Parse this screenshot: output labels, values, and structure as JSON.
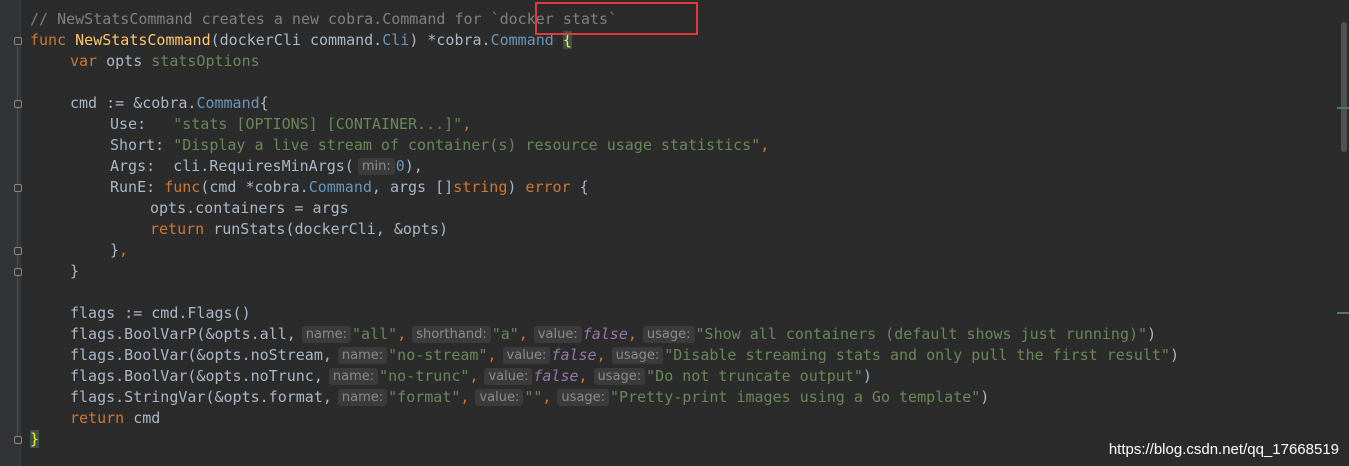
{
  "editor": {
    "lines": {
      "l1": {
        "comment_a": "// NewStatsCommand creates a new cobra.Command for ",
        "comment_b": "`docker stats`"
      },
      "l2": {
        "kw": "func",
        "name": "NewStatsCommand",
        "params": "(dockerCli command.",
        "cli_type": "Cli",
        "ret": ") *cobra.",
        "ret_type": "Command",
        "brace": "{"
      },
      "l3": {
        "kw": "var",
        "ident": " opts ",
        "type": "statsOptions"
      },
      "l5": {
        "text": "cmd := &cobra.",
        "type": "Command",
        "brace": "{"
      },
      "l6": {
        "key": "Use:   ",
        "str": "\"stats [OPTIONS] [CONTAINER...]\"",
        "end": ","
      },
      "l7": {
        "key": "Short: ",
        "str": "\"Display a live stream of container(s) resource usage statistics\"",
        "end": ","
      },
      "l8": {
        "key": "Args:  cli.RequiresMinArgs(",
        "hint": "min:",
        "num": "0",
        "end": "),"
      },
      "l9": {
        "key": "RunE: ",
        "kw": "func",
        "params": "(cmd *cobra.",
        "type": "Command",
        "mid": ", args []",
        "t2": "string",
        "end": ") ",
        "kw2": "error",
        "brace": " {"
      },
      "l10": {
        "text": "opts.containers = args"
      },
      "l11": {
        "kw": "return",
        "text": " runStats(dockerCli, &opts)"
      },
      "l12": {
        "text": "}",
        "end": ","
      },
      "l13": {
        "text": "}"
      },
      "l15": {
        "text": "flags := cmd.Flags()"
      },
      "l16": {
        "call": "flags.BoolVarP(&opts.all,",
        "h1": "name:",
        "v1": "\"all\"",
        "c1": ",",
        "h2": "shorthand:",
        "v2": "\"a\"",
        "c2": ",",
        "h3": "value:",
        "v3": "false",
        "c3": ",",
        "h4": "usage:",
        "v4": "\"Show all containers (default shows just running)\"",
        "end": ")"
      },
      "l17": {
        "call": "flags.BoolVar(&opts.noStream,",
        "h1": "name:",
        "v1": "\"no-stream\"",
        "c1": ",",
        "h2": "value:",
        "v2": "false",
        "c2": ",",
        "h3": "usage:",
        "v3": "\"Disable streaming stats and only pull the first result\"",
        "end": ")"
      },
      "l18": {
        "call": "flags.BoolVar(&opts.noTrunc,",
        "h1": "name:",
        "v1": "\"no-trunc\"",
        "c1": ",",
        "h2": "value:",
        "v2": "false",
        "c2": ",",
        "h3": "usage:",
        "v3": "\"Do not truncate output\"",
        "end": ")"
      },
      "l19": {
        "call": "flags.StringVar(&opts.format,",
        "h1": "name:",
        "v1": "\"format\"",
        "c1": ",",
        "h2": "value:",
        "v2": "\"\"",
        "c2": ",",
        "h3": "usage:",
        "v3": "\"Pretty-print images using a Go template\"",
        "end": ")"
      },
      "l20": {
        "kw": "return",
        "text": " cmd"
      },
      "l21": {
        "brace": "}"
      }
    }
  },
  "watermark": "https://blog.csdn.net/qq_17668519"
}
